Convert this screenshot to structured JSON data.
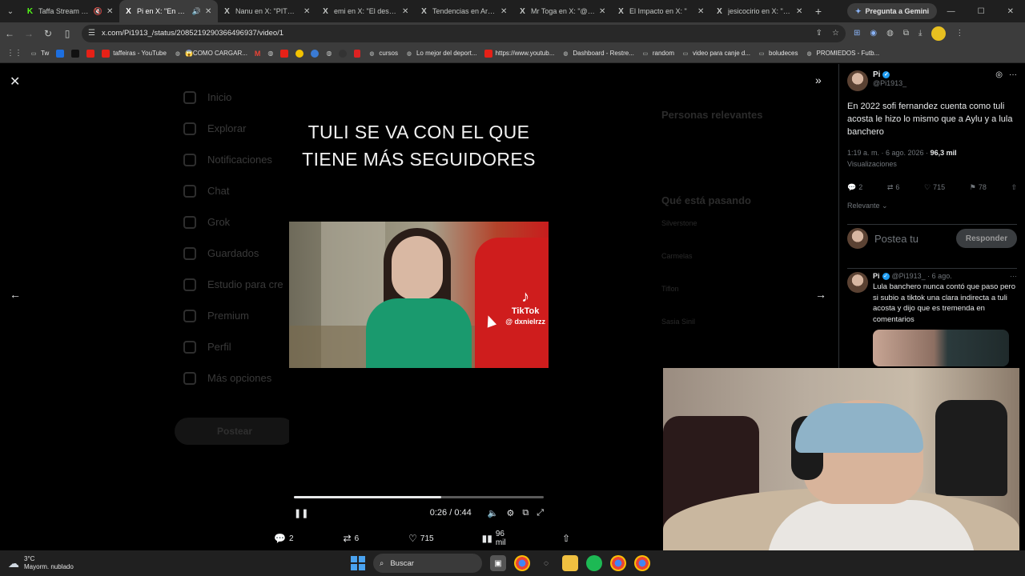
{
  "browser": {
    "tabs": [
      {
        "title": "Taffa Stream - Wa",
        "icon": "kick-icon",
        "active": false,
        "muted": true
      },
      {
        "title": "Pi en X: \"En 2022",
        "icon": "x-icon",
        "active": true,
        "audio": true
      },
      {
        "title": "Nanu en X: \"PITUFO I",
        "icon": "x-icon",
        "active": false
      },
      {
        "title": "emi en X: \"El descarg",
        "icon": "x-icon",
        "active": false
      },
      {
        "title": "Tendencias en Argent",
        "icon": "x-icon",
        "active": false
      },
      {
        "title": "Mr Toga en X: \"@lady",
        "icon": "x-icon",
        "active": false
      },
      {
        "title": "El Impacto en X: \"",
        "icon": "x-icon",
        "active": false
      },
      {
        "title": "jesicocirio en X: \"Mar",
        "icon": "x-icon",
        "active": false
      }
    ],
    "gemini_label": "Pregunta a Gemini",
    "url": "x.com/Pi1913_/status/2085219290366496937/video/1",
    "bookmarks": [
      {
        "label": "Tw",
        "icon": "folder-icon"
      },
      {
        "label": "",
        "icon": "app-icon"
      },
      {
        "label": "taffeiras - YouTube",
        "icon": "youtube-icon"
      },
      {
        "label": "😱COMO CARGAR...",
        "icon": "globe-icon"
      },
      {
        "label": "cursos",
        "icon": "globe-icon"
      },
      {
        "label": "Lo mejor del deport...",
        "icon": "globe-icon"
      },
      {
        "label": "https://www.youtub...",
        "icon": "youtube-icon"
      },
      {
        "label": "Dashboard - Restre...",
        "icon": "globe-icon"
      },
      {
        "label": "random",
        "icon": "folder-icon"
      },
      {
        "label": "video para canje d...",
        "icon": "folder-icon"
      },
      {
        "label": "boludeces",
        "icon": "folder-icon"
      },
      {
        "label": "PROMIEDOS - Futb...",
        "icon": "globe-icon"
      }
    ]
  },
  "background_nav": [
    "Inicio",
    "Explorar",
    "Notificaciones",
    "Chat",
    "Grok",
    "Guardados",
    "Estudio para cre",
    "Premium",
    "Perfil",
    "Más opciones"
  ],
  "background_post": "Postear",
  "background_right": {
    "h1": "Personas relevantes",
    "h2": "Qué está pasando",
    "trends": [
      "Silverstone",
      "Carmelas",
      "Tiflon",
      "Sasia Sinil"
    ]
  },
  "video": {
    "caption": "TULI SE VA CON EL QUE TIENE MÁS SEGUIDORES",
    "tiktok_name": "TikTok",
    "tiktok_handle": "@ dxnielrzz",
    "time": "0:26 / 0:44",
    "progress": 0.59
  },
  "media_actions": {
    "replies": "2",
    "reposts": "6",
    "likes": "715",
    "views": "96 mil"
  },
  "sidebar": {
    "post": {
      "name": "Pi",
      "handle": "@Pi1913_",
      "text": "En 2022 sofi fernandez cuenta como tuli acosta le hizo lo mismo que a Aylu y a lula banchero",
      "time": "1:19 a. m. · 6 ago. 2026 · ",
      "views": "96,3 mil",
      "views_label": "Visualizaciones",
      "replies": "2",
      "reposts": "6",
      "likes": "715",
      "bookmarks": "78"
    },
    "relevance": "Relevante",
    "reply_placeholder": "Postea tu",
    "reply_button": "Responder",
    "reply": {
      "name": "Pi",
      "handle": "@Pi1913_ · 6 ago.",
      "text": "Lula banchero nunca contó que paso pero si subio a tiktok  una clara indirecta a tuli acosta y dijo que es tremenda en comentarios"
    }
  },
  "taskbar": {
    "temp": "3°C",
    "weather": "Mayorm. nublado",
    "search": "Buscar"
  }
}
